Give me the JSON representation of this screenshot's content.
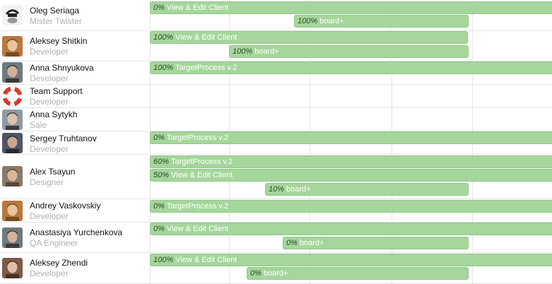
{
  "people": [
    {
      "name": "Oleg Seriaga",
      "role": "Mister Twister",
      "avatar": "avatar-sketch-icon",
      "bars": [
        {
          "pct": "0%",
          "title": "View & Edit Client"
        },
        {
          "pct": "100%",
          "title": "board+"
        }
      ]
    },
    {
      "name": "Aleksey Shitkin",
      "role": "Developer",
      "avatar": "avatar-photo-icon",
      "bars": [
        {
          "pct": "100%",
          "title": "View & Edit Client"
        },
        {
          "pct": "100%",
          "title": "board+"
        }
      ]
    },
    {
      "name": "Anna Shnyukova",
      "role": "Developer",
      "avatar": "avatar-photo-icon",
      "bars": [
        {
          "pct": "100%",
          "title": "TargetProcess v.2"
        }
      ]
    },
    {
      "name": "Team Support",
      "role": "Developer",
      "avatar": "lifebuoy-icon",
      "bars": []
    },
    {
      "name": "Anna Sytykh",
      "role": "Sale",
      "avatar": "avatar-photo-icon",
      "bars": []
    },
    {
      "name": "Sergey Truhtanov",
      "role": "Developer",
      "avatar": "avatar-photo-icon",
      "bars": [
        {
          "pct": "0%",
          "title": "TargetProcess v.2"
        }
      ]
    },
    {
      "name": "Alex Tsayun",
      "role": "Designer",
      "avatar": "avatar-photo-icon",
      "bars": [
        {
          "pct": "60%",
          "title": "TargetProcess v.2"
        },
        {
          "pct": "50%",
          "title": "View & Edit Client"
        },
        {
          "pct": "10%",
          "title": "board+"
        }
      ]
    },
    {
      "name": "Andrey Vaskovskiy",
      "role": "Developer",
      "avatar": "avatar-photo-icon",
      "bars": [
        {
          "pct": "0%",
          "title": "TargetProcess v.2"
        }
      ]
    },
    {
      "name": "Anastasiya Yurchenkova",
      "role": "QA Engineer",
      "avatar": "avatar-photo-icon",
      "bars": [
        {
          "pct": "0%",
          "title": "View & Edit Client"
        },
        {
          "pct": "0%",
          "title": "board+"
        }
      ]
    },
    {
      "name": "Aleksey Zhendi",
      "role": "Developer",
      "avatar": "avatar-photo-icon",
      "bars": [
        {
          "pct": "100%",
          "title": "View & Edit Client"
        },
        {
          "pct": "0%",
          "title": "board+"
        }
      ]
    }
  ],
  "colors": {
    "bar_fill": "#a5d69c",
    "bar_border": "#8fc788",
    "role_text": "#b0b0b0"
  }
}
